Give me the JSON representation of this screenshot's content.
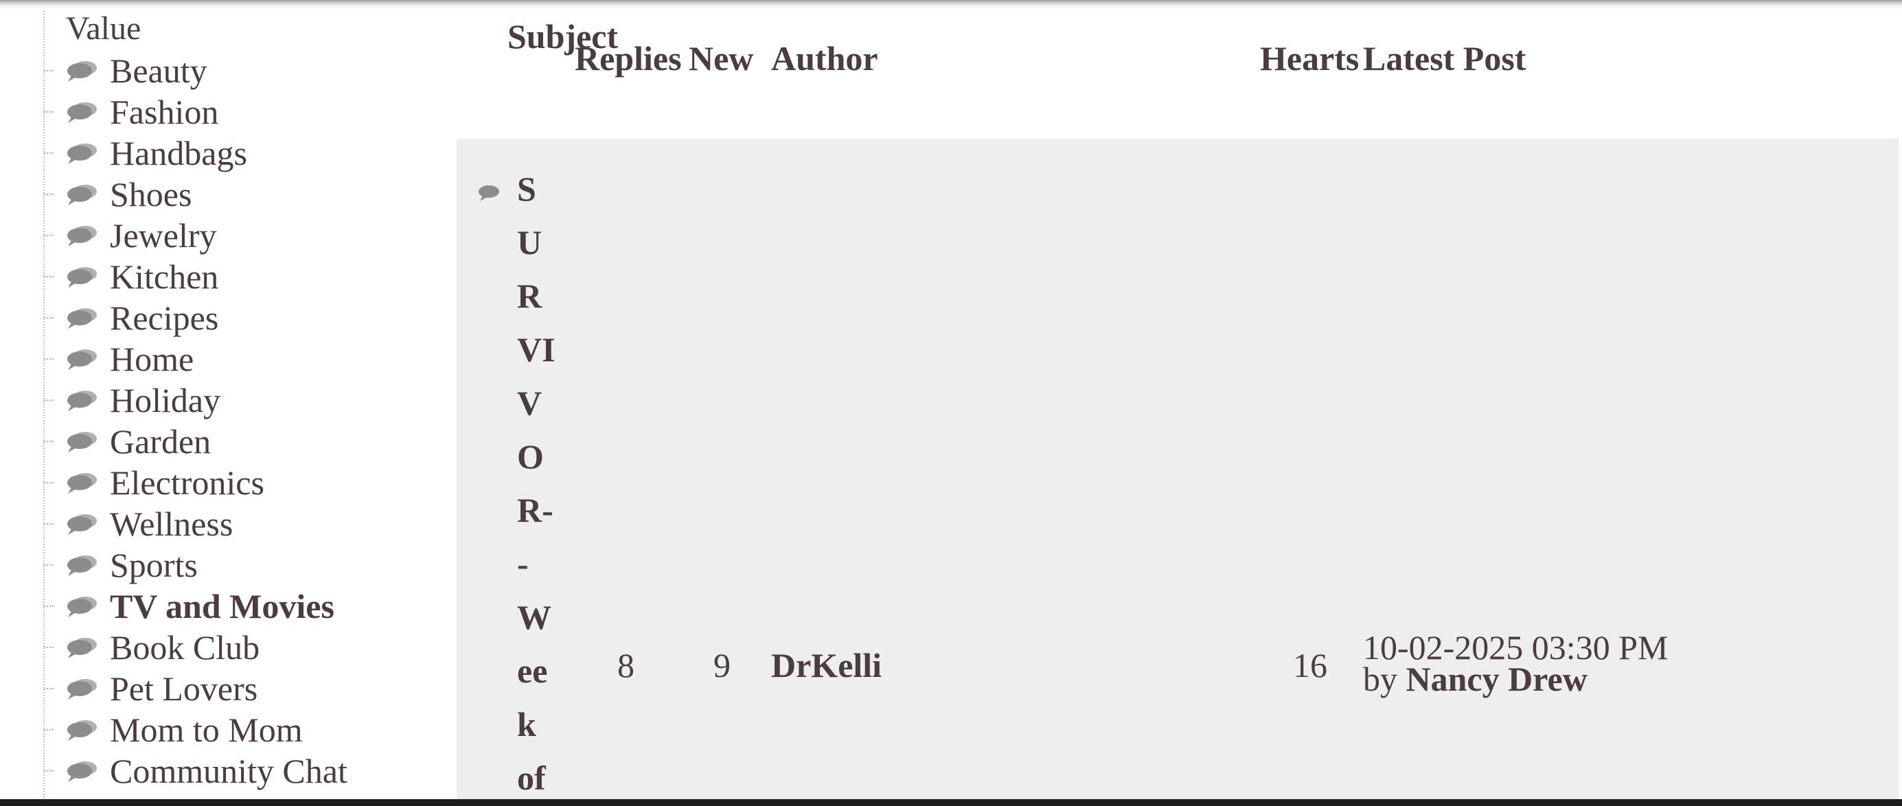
{
  "sidebar": {
    "heading": "Value",
    "items": [
      {
        "label": "Beauty"
      },
      {
        "label": "Fashion"
      },
      {
        "label": "Handbags"
      },
      {
        "label": "Shoes"
      },
      {
        "label": "Jewelry"
      },
      {
        "label": "Kitchen"
      },
      {
        "label": "Recipes"
      },
      {
        "label": "Home"
      },
      {
        "label": "Holiday"
      },
      {
        "label": "Garden"
      },
      {
        "label": "Electronics"
      },
      {
        "label": "Wellness"
      },
      {
        "label": "Sports"
      },
      {
        "label": "TV and Movies",
        "active": true
      },
      {
        "label": "Book Club"
      },
      {
        "label": "Pet Lovers"
      },
      {
        "label": "Mom to Mom"
      },
      {
        "label": "Community Chat"
      }
    ]
  },
  "table": {
    "headers": {
      "subject": "Subject",
      "replies": "Replies",
      "new": "New",
      "author": "Author",
      "hearts": "Hearts",
      "latest_post": "Latest Post"
    },
    "rows": [
      {
        "subject": "SURVIVOR--Week of",
        "replies": "8",
        "new": "9",
        "author": "DrKelli",
        "hearts": "16",
        "latest_post_date": "10-02-2025 03:30 PM",
        "latest_post_by_prefix": "by",
        "latest_post_by": "Nancy Drew"
      }
    ]
  },
  "icons": {
    "sidebar_item_icon": "speech-bubbles-icon",
    "row_icon": "speech-bubble-icon"
  },
  "colors": {
    "text": "#4a3c42",
    "row_background": "#eeeeee",
    "icon": "#8c8c8c"
  }
}
